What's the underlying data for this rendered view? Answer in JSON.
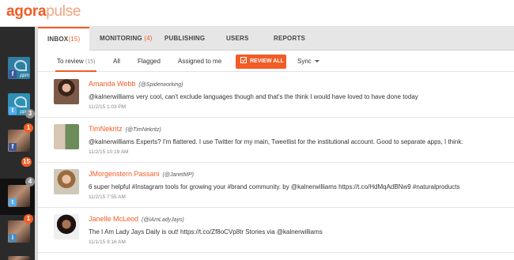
{
  "brand": {
    "part1": "agora",
    "part2": "pulse",
    "accent": "#f25c26"
  },
  "tabs": [
    {
      "label": "INBOX",
      "count": "(15)"
    },
    {
      "label": "MONITORING",
      "count": "(4)"
    },
    {
      "label": "PUBLISHING",
      "count": ""
    },
    {
      "label": "USERS",
      "count": ""
    },
    {
      "label": "REPORTS",
      "count": ""
    }
  ],
  "subtabs": {
    "to_review": "To review",
    "to_review_count": "(15)",
    "all": "All",
    "flagged": "Flagged",
    "assigned": "Assigned to me",
    "review_all": "REVIEW ALL",
    "sync": "Sync"
  },
  "accounts": [
    {
      "network": "facebook",
      "icon": "f",
      "tag": "ppm",
      "badge": ""
    },
    {
      "network": "twitter",
      "icon": "t",
      "tag": "ppm",
      "badge": "3"
    },
    {
      "network": "facebook",
      "icon": "f",
      "tag": "",
      "badge": "1"
    },
    {
      "network": "twitter",
      "icon": "t",
      "tag": "",
      "badge": "15",
      "badge2": "4"
    },
    {
      "network": "instagram",
      "icon": "i",
      "tag": "",
      "badge": "1"
    },
    {
      "network": "twitter",
      "icon": "t",
      "tag": "",
      "badge": ""
    }
  ],
  "messages": [
    {
      "name": "Amanda Webb",
      "handle": "(@Spiderworking)",
      "text": "@kalnerwilliams very cool, can't exclude languages though and that's the think I would have loved to have done today",
      "time": "11/2/15 1:03 PM"
    },
    {
      "name": "TimNekritz",
      "handle": "(@TimNekritz)",
      "text": "@kalnerwilliams Experts? I'm flattered. I use Twitter for my main, Tweetlist for the institutional account. Good to separate apps, I think.",
      "time": "11/2/15 10:19 AM"
    },
    {
      "name": "JMorgenstern Passani",
      "handle": "(@JanetMP)",
      "text": "6 super helpful #Instagram tools for growing your #brand community. by @kalnerwilliams https://t.co/HdMqAdBNw9 #naturalproducts",
      "time": "11/2/15 7:55 AM"
    },
    {
      "name": "Janelle McLeod",
      "handle": "(@IAmLadyJays)",
      "text": "The I Am Lady Jays Daily is out! https://t.co/Zf8oCVp8tr Stories via @kalnerwilliams",
      "time": "11/1/15 9:16 AM"
    }
  ]
}
